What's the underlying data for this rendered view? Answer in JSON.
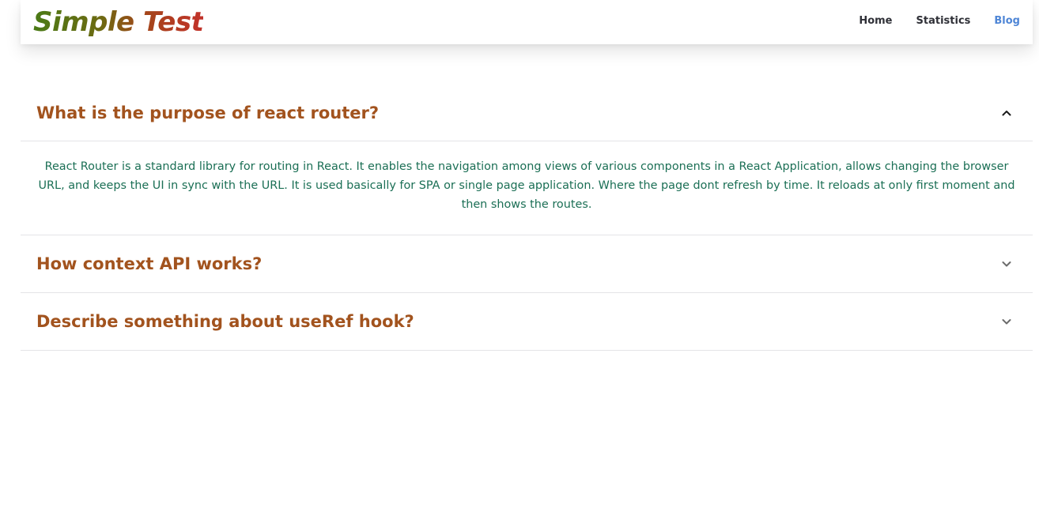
{
  "brand": {
    "logo_text": "Simple Test"
  },
  "nav": {
    "links": [
      {
        "label": "Home"
      },
      {
        "label": "Statistics"
      },
      {
        "label": "Blog"
      }
    ],
    "active": "Blog"
  },
  "accordion": {
    "items": [
      {
        "title": "What is the purpose of react router?",
        "expanded": true,
        "body": "React Router is a standard library for routing in React. It enables the navigation among views of various components in a React Application, allows changing the browser URL, and keeps the UI in sync with the URL. It is used basically for SPA or single page application. Where the page dont refresh by time. It reloads at only first moment and then shows the routes."
      },
      {
        "title": "How context API works?",
        "expanded": false
      },
      {
        "title": "Describe something about useRef hook?",
        "expanded": false
      }
    ]
  },
  "colors": {
    "title": "#a2531e",
    "body_text": "#1b6f55",
    "nav_active": "#4f86d6",
    "nav_text": "#2f3037",
    "divider": "#e4e4e7"
  },
  "icons": {
    "expanded": "chevron-up-icon",
    "collapsed": "chevron-down-icon"
  }
}
